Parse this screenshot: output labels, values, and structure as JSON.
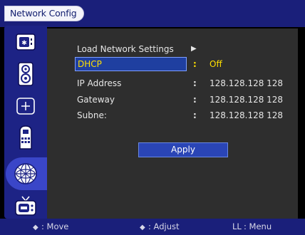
{
  "header": {
    "title": "Network Config"
  },
  "sidebar": {
    "items": [
      {
        "icon": "display-settings-icon"
      },
      {
        "icon": "speaker-icon"
      },
      {
        "icon": "crosshair-icon"
      },
      {
        "icon": "device-remote-icon"
      },
      {
        "icon": "network-globe-icon",
        "selected": true
      },
      {
        "icon": "tv-icon"
      }
    ]
  },
  "menu": {
    "load_label": "Load Network Settings",
    "load_arrow": "▶",
    "dhcp_label": "DHCP",
    "dhcp_value": "Off",
    "dhcp_sep": ":",
    "ip_label": "IP Address",
    "ip_value": "128.128.128 128",
    "gateway_label": "Gateway",
    "gateway_value": "128.128.128 128",
    "subnet_label": "Subne:",
    "subnet_value": "128.128.128 128",
    "colon": ":"
  },
  "apply_label": "Apply",
  "footer": {
    "move_icon": "◆",
    "move_label": ": Move",
    "adjust_icon": "◆",
    "adjust_label": ": Adjust",
    "menu_icon": "LL",
    "menu_label": ": Menu"
  },
  "colors": {
    "topbar": "#1a1f7a",
    "sidebar": "#1d2385",
    "panel": "#2e2e2e",
    "highlight_text": "#ffe000",
    "selected_row": "#1f3fa0"
  }
}
